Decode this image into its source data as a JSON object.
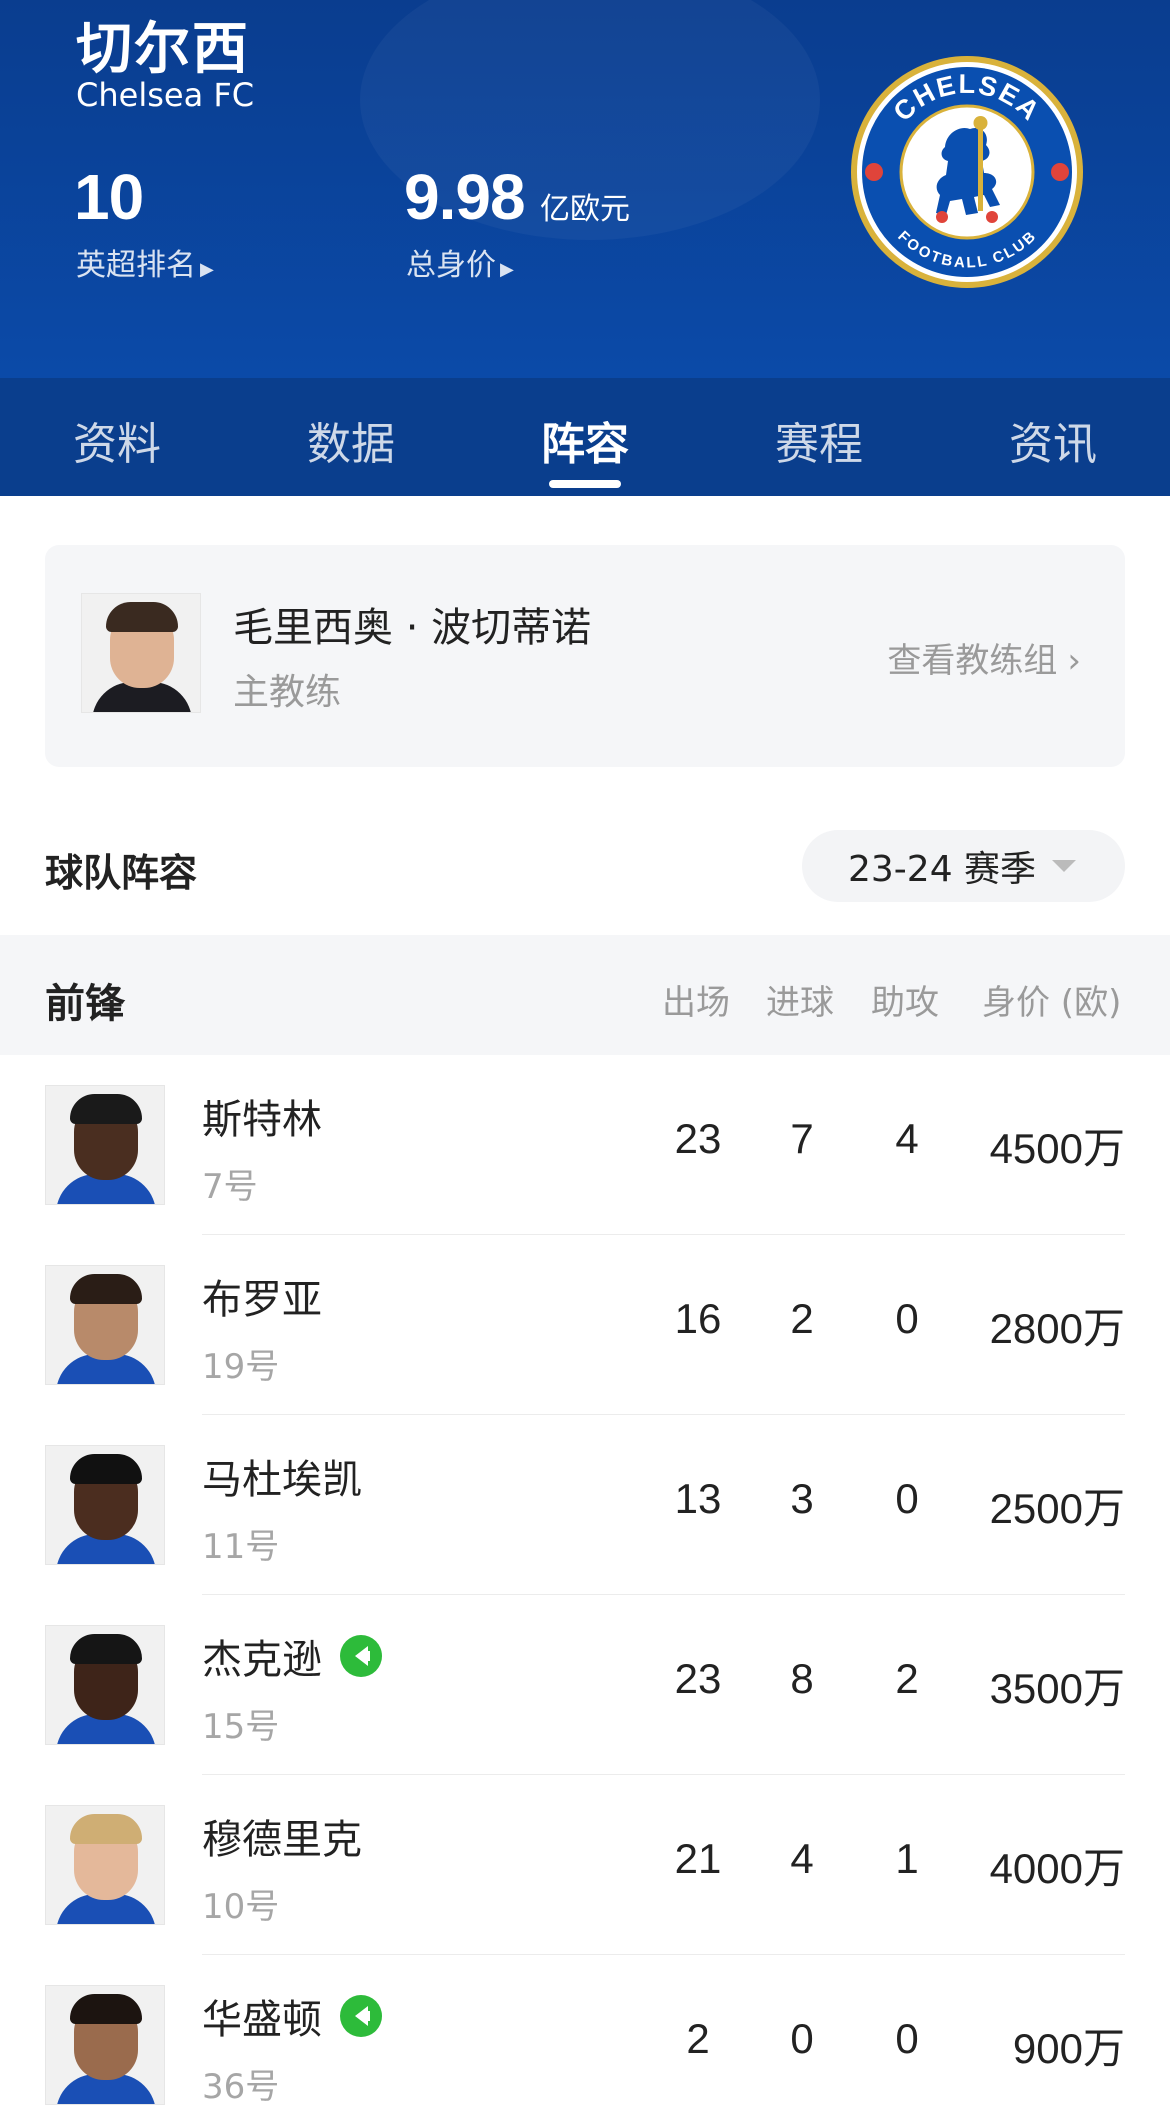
{
  "team": {
    "name_cn": "切尔西",
    "name_en": "Chelsea FC",
    "rank_value": "10",
    "rank_label": "英超排名",
    "value_number": "9.98",
    "value_unit": "亿欧元",
    "value_label": "总身价",
    "crest": {
      "top_text": "CHELSEA",
      "bottom_text": "FOOTBALL CLUB",
      "colors": {
        "blue": "#0a4fb0",
        "gold": "#d9b23b",
        "red": "#e0443a"
      }
    }
  },
  "tabs": [
    {
      "label": "资料",
      "active": false
    },
    {
      "label": "数据",
      "active": false
    },
    {
      "label": "阵容",
      "active": true
    },
    {
      "label": "赛程",
      "active": false
    },
    {
      "label": "资讯",
      "active": false
    }
  ],
  "coach": {
    "name": "毛里西奥 · 波切蒂诺",
    "role": "主教练",
    "link": "查看教练组"
  },
  "squad": {
    "title": "球队阵容",
    "season": "23-24 赛季"
  },
  "position_group": {
    "name": "前锋",
    "columns": [
      "出场",
      "进球",
      "助攻",
      "身价 (欧)"
    ]
  },
  "players": [
    {
      "name": "斯特林",
      "number": "7号",
      "apps": "23",
      "goals": "7",
      "assists": "4",
      "value": "4500万",
      "badge": false,
      "skin": "#4a2e20",
      "hair": "#1a1a1a"
    },
    {
      "name": "布罗亚",
      "number": "19号",
      "apps": "16",
      "goals": "2",
      "assists": "0",
      "value": "2800万",
      "badge": false,
      "skin": "#b88a6a",
      "hair": "#2a1d16"
    },
    {
      "name": "马杜埃凯",
      "number": "11号",
      "apps": "13",
      "goals": "3",
      "assists": "0",
      "value": "2500万",
      "badge": false,
      "skin": "#4b2d1f",
      "hair": "#111111"
    },
    {
      "name": "杰克逊",
      "number": "15号",
      "apps": "23",
      "goals": "8",
      "assists": "2",
      "value": "3500万",
      "badge": true,
      "skin": "#3e2419",
      "hair": "#151515"
    },
    {
      "name": "穆德里克",
      "number": "10号",
      "apps": "21",
      "goals": "4",
      "assists": "1",
      "value": "4000万",
      "badge": false,
      "skin": "#e4b89a",
      "hair": "#cfae74"
    },
    {
      "name": "华盛顿",
      "number": "36号",
      "apps": "2",
      "goals": "0",
      "assists": "0",
      "value": "900万",
      "badge": true,
      "skin": "#9a6b4d",
      "hair": "#1c1410"
    }
  ]
}
